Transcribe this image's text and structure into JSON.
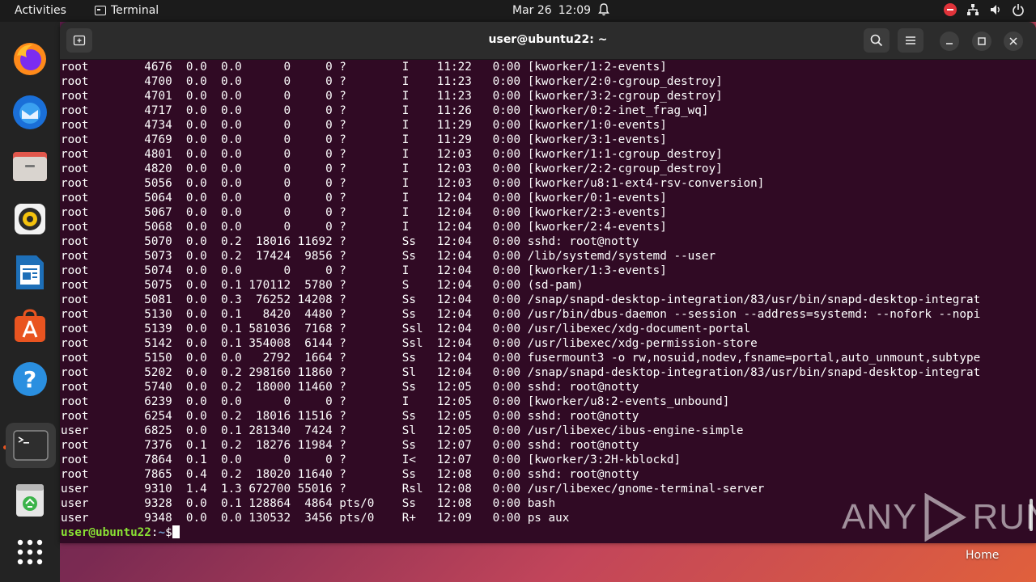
{
  "topbar": {
    "activities": "Activities",
    "app_name": "Terminal",
    "date": "Mar 26",
    "time": "12:09"
  },
  "dock": {
    "items": [
      {
        "name": "firefox-icon"
      },
      {
        "name": "thunderbird-icon"
      },
      {
        "name": "files-icon"
      },
      {
        "name": "rhythmbox-icon"
      },
      {
        "name": "libreoffice-writer-icon"
      },
      {
        "name": "app-center-icon"
      },
      {
        "name": "help-icon"
      },
      {
        "name": "terminal-icon"
      },
      {
        "name": "trash-icon"
      },
      {
        "name": "show-apps-icon"
      }
    ]
  },
  "window": {
    "title": "user@ubuntu22: ~"
  },
  "terminal": {
    "lines": [
      "root        4676  0.0  0.0      0     0 ?        I    11:22   0:00 [kworker/1:2-events]",
      "root        4700  0.0  0.0      0     0 ?        I    11:23   0:00 [kworker/2:0-cgroup_destroy]",
      "root        4701  0.0  0.0      0     0 ?        I    11:23   0:00 [kworker/3:2-cgroup_destroy]",
      "root        4717  0.0  0.0      0     0 ?        I    11:26   0:00 [kworker/0:2-inet_frag_wq]",
      "root        4734  0.0  0.0      0     0 ?        I    11:29   0:00 [kworker/1:0-events]",
      "root        4769  0.0  0.0      0     0 ?        I    11:29   0:00 [kworker/3:1-events]",
      "root        4801  0.0  0.0      0     0 ?        I    12:03   0:00 [kworker/1:1-cgroup_destroy]",
      "root        4820  0.0  0.0      0     0 ?        I    12:03   0:00 [kworker/2:2-cgroup_destroy]",
      "root        5056  0.0  0.0      0     0 ?        I    12:03   0:00 [kworker/u8:1-ext4-rsv-conversion]",
      "root        5064  0.0  0.0      0     0 ?        I    12:04   0:00 [kworker/0:1-events]",
      "root        5067  0.0  0.0      0     0 ?        I    12:04   0:00 [kworker/2:3-events]",
      "root        5068  0.0  0.0      0     0 ?        I    12:04   0:00 [kworker/2:4-events]",
      "root        5070  0.0  0.2  18016 11692 ?        Ss   12:04   0:00 sshd: root@notty",
      "root        5073  0.0  0.2  17424  9856 ?        Ss   12:04   0:00 /lib/systemd/systemd --user",
      "root        5074  0.0  0.0      0     0 ?        I    12:04   0:00 [kworker/1:3-events]",
      "root        5075  0.0  0.1 170112  5780 ?        S    12:04   0:00 (sd-pam)",
      "root        5081  0.0  0.3  76252 14208 ?        Ss   12:04   0:00 /snap/snapd-desktop-integration/83/usr/bin/snapd-desktop-integrat",
      "root        5130  0.0  0.1   8420  4480 ?        Ss   12:04   0:00 /usr/bin/dbus-daemon --session --address=systemd: --nofork --nopi",
      "root        5139  0.0  0.1 581036  7168 ?        Ssl  12:04   0:00 /usr/libexec/xdg-document-portal",
      "root        5142  0.0  0.1 354008  6144 ?        Ssl  12:04   0:00 /usr/libexec/xdg-permission-store",
      "root        5150  0.0  0.0   2792  1664 ?        Ss   12:04   0:00 fusermount3 -o rw,nosuid,nodev,fsname=portal,auto_unmount,subtype",
      "root        5202  0.0  0.2 298160 11860 ?        Sl   12:04   0:00 /snap/snapd-desktop-integration/83/usr/bin/snapd-desktop-integrat",
      "root        5740  0.0  0.2  18000 11460 ?        Ss   12:05   0:00 sshd: root@notty",
      "root        6239  0.0  0.0      0     0 ?        I    12:05   0:00 [kworker/u8:2-events_unbound]",
      "root        6254  0.0  0.2  18016 11516 ?        Ss   12:05   0:00 sshd: root@notty",
      "user        6825  0.0  0.1 281340  7424 ?        Sl   12:05   0:00 /usr/libexec/ibus-engine-simple",
      "root        7376  0.1  0.2  18276 11984 ?        Ss   12:07   0:00 sshd: root@notty",
      "root        7864  0.1  0.0      0     0 ?        I<   12:07   0:00 [kworker/3:2H-kblockd]",
      "root        7865  0.4  0.2  18020 11640 ?        Ss   12:08   0:00 sshd: root@notty",
      "user        9310  1.4  1.3 672700 55016 ?        Rsl  12:08   0:00 /usr/libexec/gnome-terminal-server",
      "user        9328  0.0  0.1 128864  4864 pts/0    Ss   12:08   0:00 bash",
      "user        9348  0.0  0.0 130532  3456 pts/0    R+   12:09   0:00 ps aux"
    ],
    "prompt_user": "user@ubuntu22",
    "prompt_sep": ":",
    "prompt_path": "~",
    "prompt_symbol": "$"
  },
  "watermark": {
    "left": "ANY",
    "right": "RUN"
  },
  "desktop": {
    "home_label": "Home"
  }
}
